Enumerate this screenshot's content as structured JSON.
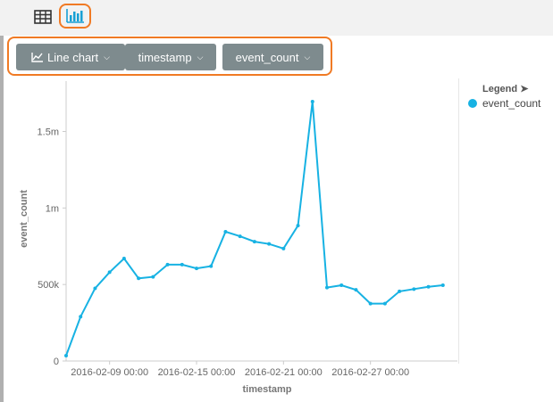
{
  "toolbar": {
    "table_icon": "table-icon",
    "chart_icon": "bar-chart-icon"
  },
  "controls": {
    "chart_type": "Line chart",
    "x_field": "timestamp",
    "y_field": "event_count"
  },
  "legend": {
    "title": "Legend",
    "items": [
      "event_count"
    ]
  },
  "colors": {
    "series": "#17b2e3",
    "accent": "#f07a24",
    "button": "#7e8b8e"
  },
  "chart_data": {
    "type": "line",
    "xlabel": "timestamp",
    "ylabel": "event_count",
    "ylim": [
      0,
      1800000
    ],
    "xlim": [
      "2016-02-06",
      "2016-03-04"
    ],
    "y_ticks": [
      {
        "value": 0,
        "label": "0"
      },
      {
        "value": 500000,
        "label": "500k"
      },
      {
        "value": 1000000,
        "label": "1m"
      },
      {
        "value": 1500000,
        "label": "1.5m"
      }
    ],
    "x_ticks": [
      {
        "value": "2016-02-09",
        "label": "2016-02-09 00:00"
      },
      {
        "value": "2016-02-15",
        "label": "2016-02-15 00:00"
      },
      {
        "value": "2016-02-21",
        "label": "2016-02-21 00:00"
      },
      {
        "value": "2016-02-27",
        "label": "2016-02-27 00:00"
      }
    ],
    "series": [
      {
        "name": "event_count",
        "x": [
          "2016-02-06",
          "2016-02-07",
          "2016-02-08",
          "2016-02-09",
          "2016-02-10",
          "2016-02-11",
          "2016-02-12",
          "2016-02-13",
          "2016-02-14",
          "2016-02-15",
          "2016-02-16",
          "2016-02-17",
          "2016-02-18",
          "2016-02-19",
          "2016-02-20",
          "2016-02-21",
          "2016-02-22",
          "2016-02-23",
          "2016-02-24",
          "2016-02-25",
          "2016-02-26",
          "2016-02-27",
          "2016-02-28",
          "2016-02-29",
          "2016-03-01",
          "2016-03-02",
          "2016-03-03"
        ],
        "values": [
          35000,
          290000,
          475000,
          580000,
          670000,
          540000,
          550000,
          630000,
          630000,
          605000,
          620000,
          845000,
          815000,
          780000,
          765000,
          735000,
          885000,
          1695000,
          480000,
          495000,
          465000,
          375000,
          375000,
          455000,
          470000,
          485000,
          495000
        ]
      }
    ]
  }
}
